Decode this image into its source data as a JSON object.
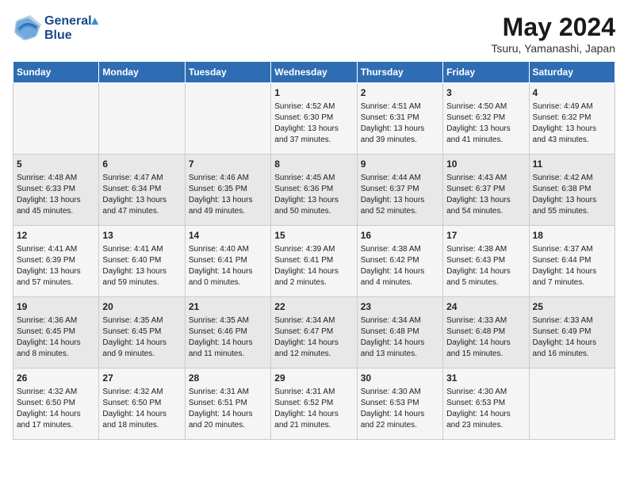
{
  "logo": {
    "line1": "General",
    "line2": "Blue"
  },
  "title": "May 2024",
  "location": "Tsuru, Yamanashi, Japan",
  "days_of_week": [
    "Sunday",
    "Monday",
    "Tuesday",
    "Wednesday",
    "Thursday",
    "Friday",
    "Saturday"
  ],
  "weeks": [
    [
      {
        "num": "",
        "info": ""
      },
      {
        "num": "",
        "info": ""
      },
      {
        "num": "",
        "info": ""
      },
      {
        "num": "1",
        "info": "Sunrise: 4:52 AM\nSunset: 6:30 PM\nDaylight: 13 hours and 37 minutes."
      },
      {
        "num": "2",
        "info": "Sunrise: 4:51 AM\nSunset: 6:31 PM\nDaylight: 13 hours and 39 minutes."
      },
      {
        "num": "3",
        "info": "Sunrise: 4:50 AM\nSunset: 6:32 PM\nDaylight: 13 hours and 41 minutes."
      },
      {
        "num": "4",
        "info": "Sunrise: 4:49 AM\nSunset: 6:32 PM\nDaylight: 13 hours and 43 minutes."
      }
    ],
    [
      {
        "num": "5",
        "info": "Sunrise: 4:48 AM\nSunset: 6:33 PM\nDaylight: 13 hours and 45 minutes."
      },
      {
        "num": "6",
        "info": "Sunrise: 4:47 AM\nSunset: 6:34 PM\nDaylight: 13 hours and 47 minutes."
      },
      {
        "num": "7",
        "info": "Sunrise: 4:46 AM\nSunset: 6:35 PM\nDaylight: 13 hours and 49 minutes."
      },
      {
        "num": "8",
        "info": "Sunrise: 4:45 AM\nSunset: 6:36 PM\nDaylight: 13 hours and 50 minutes."
      },
      {
        "num": "9",
        "info": "Sunrise: 4:44 AM\nSunset: 6:37 PM\nDaylight: 13 hours and 52 minutes."
      },
      {
        "num": "10",
        "info": "Sunrise: 4:43 AM\nSunset: 6:37 PM\nDaylight: 13 hours and 54 minutes."
      },
      {
        "num": "11",
        "info": "Sunrise: 4:42 AM\nSunset: 6:38 PM\nDaylight: 13 hours and 55 minutes."
      }
    ],
    [
      {
        "num": "12",
        "info": "Sunrise: 4:41 AM\nSunset: 6:39 PM\nDaylight: 13 hours and 57 minutes."
      },
      {
        "num": "13",
        "info": "Sunrise: 4:41 AM\nSunset: 6:40 PM\nDaylight: 13 hours and 59 minutes."
      },
      {
        "num": "14",
        "info": "Sunrise: 4:40 AM\nSunset: 6:41 PM\nDaylight: 14 hours and 0 minutes."
      },
      {
        "num": "15",
        "info": "Sunrise: 4:39 AM\nSunset: 6:41 PM\nDaylight: 14 hours and 2 minutes."
      },
      {
        "num": "16",
        "info": "Sunrise: 4:38 AM\nSunset: 6:42 PM\nDaylight: 14 hours and 4 minutes."
      },
      {
        "num": "17",
        "info": "Sunrise: 4:38 AM\nSunset: 6:43 PM\nDaylight: 14 hours and 5 minutes."
      },
      {
        "num": "18",
        "info": "Sunrise: 4:37 AM\nSunset: 6:44 PM\nDaylight: 14 hours and 7 minutes."
      }
    ],
    [
      {
        "num": "19",
        "info": "Sunrise: 4:36 AM\nSunset: 6:45 PM\nDaylight: 14 hours and 8 minutes."
      },
      {
        "num": "20",
        "info": "Sunrise: 4:35 AM\nSunset: 6:45 PM\nDaylight: 14 hours and 9 minutes."
      },
      {
        "num": "21",
        "info": "Sunrise: 4:35 AM\nSunset: 6:46 PM\nDaylight: 14 hours and 11 minutes."
      },
      {
        "num": "22",
        "info": "Sunrise: 4:34 AM\nSunset: 6:47 PM\nDaylight: 14 hours and 12 minutes."
      },
      {
        "num": "23",
        "info": "Sunrise: 4:34 AM\nSunset: 6:48 PM\nDaylight: 14 hours and 13 minutes."
      },
      {
        "num": "24",
        "info": "Sunrise: 4:33 AM\nSunset: 6:48 PM\nDaylight: 14 hours and 15 minutes."
      },
      {
        "num": "25",
        "info": "Sunrise: 4:33 AM\nSunset: 6:49 PM\nDaylight: 14 hours and 16 minutes."
      }
    ],
    [
      {
        "num": "26",
        "info": "Sunrise: 4:32 AM\nSunset: 6:50 PM\nDaylight: 14 hours and 17 minutes."
      },
      {
        "num": "27",
        "info": "Sunrise: 4:32 AM\nSunset: 6:50 PM\nDaylight: 14 hours and 18 minutes."
      },
      {
        "num": "28",
        "info": "Sunrise: 4:31 AM\nSunset: 6:51 PM\nDaylight: 14 hours and 20 minutes."
      },
      {
        "num": "29",
        "info": "Sunrise: 4:31 AM\nSunset: 6:52 PM\nDaylight: 14 hours and 21 minutes."
      },
      {
        "num": "30",
        "info": "Sunrise: 4:30 AM\nSunset: 6:53 PM\nDaylight: 14 hours and 22 minutes."
      },
      {
        "num": "31",
        "info": "Sunrise: 4:30 AM\nSunset: 6:53 PM\nDaylight: 14 hours and 23 minutes."
      },
      {
        "num": "",
        "info": ""
      }
    ]
  ]
}
